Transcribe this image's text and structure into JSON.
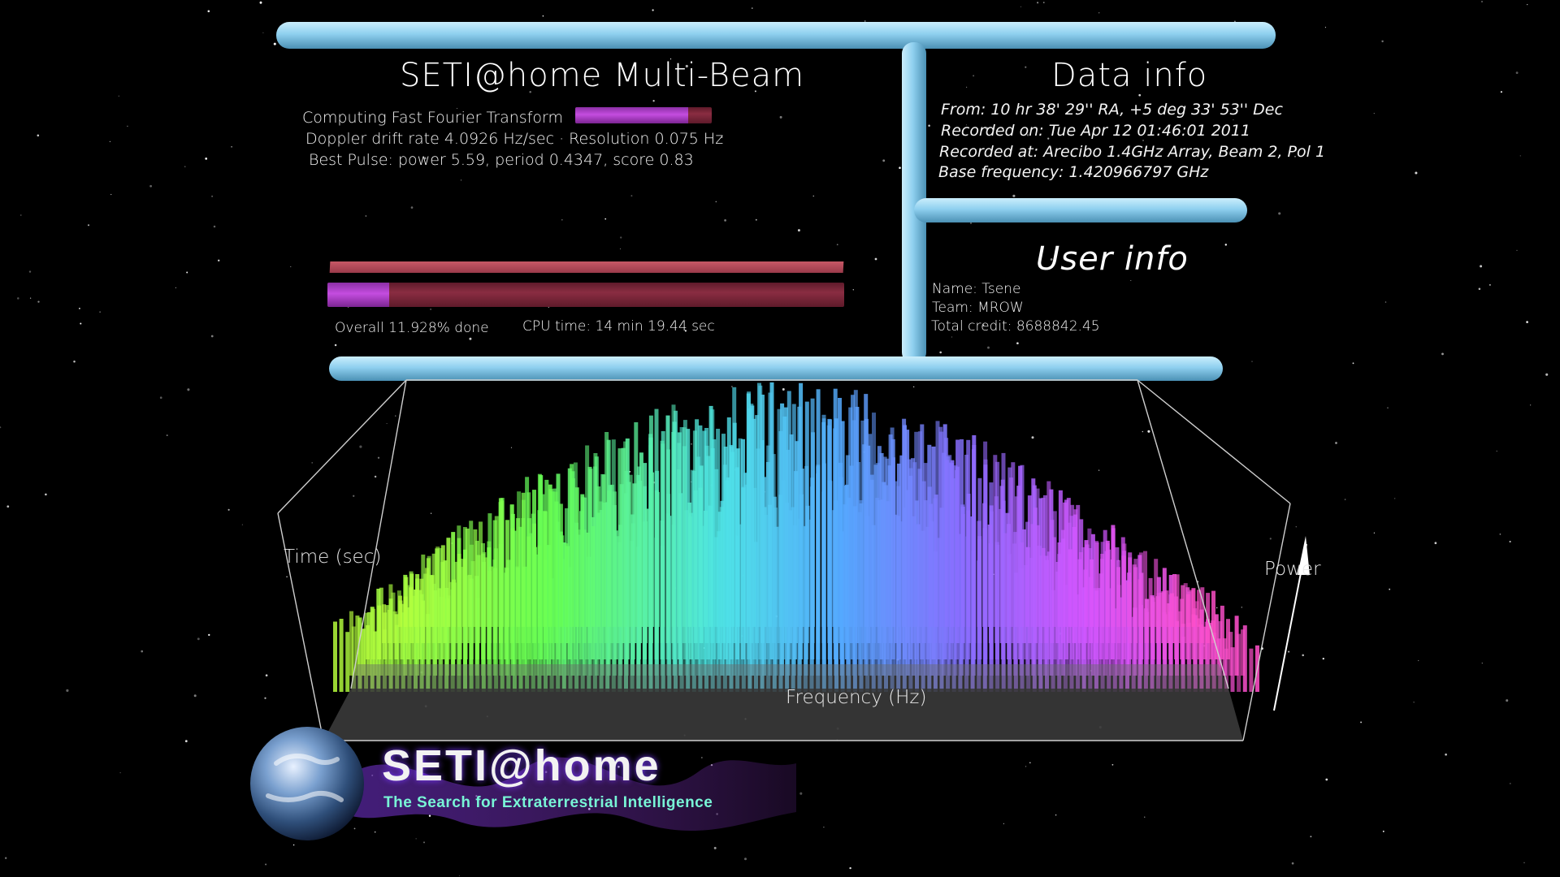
{
  "main_panel": {
    "title": "SETI@home  Multi-Beam",
    "status_line": "Computing  Fast  Fourier  Transform",
    "status_progress": 0.83,
    "doppler_line": "Doppler  drift  rate  4.0926  Hz/sec  · Resolution  0.075  Hz",
    "pulse_line": "Best  Pulse:  power    5.59,  period  0.4347,  score    0.83",
    "overall_progress": 0.119,
    "overall_line": "Overall  11.928%  done",
    "cpu_line": "CPU  time:  14  min  19.44  sec"
  },
  "data_info": {
    "title": "Data  info",
    "from": "From:  10  hr  38'  29''  RA,  +5  deg  33'  53''  Dec",
    "recorded_on": "Recorded  on:  Tue  Apr  12  01:46:01  2011",
    "recorded_at": "Recorded  at:  Arecibo  1.4GHz  Array,  Beam  2,  Pol  1",
    "base_frequency": "Base  frequency:  1.420966797  GHz"
  },
  "user_info": {
    "title": "User  info",
    "name": "Name:  Tsene",
    "team": "Team:  MROW",
    "credit": "Total  credit:  8688842.45"
  },
  "graph": {
    "time_label": "Time  (sec)",
    "power_label": "Power",
    "frequency_label": "Frequency  (Hz)"
  },
  "logo": {
    "name": "SETI@home",
    "tagline": "The Search for Extraterrestrial Intelligence"
  },
  "colors": {
    "pipe": "#8fd0ef",
    "progress_fill": "#c44ddf",
    "progress_track": "#8a2d42",
    "background": "#000000"
  }
}
